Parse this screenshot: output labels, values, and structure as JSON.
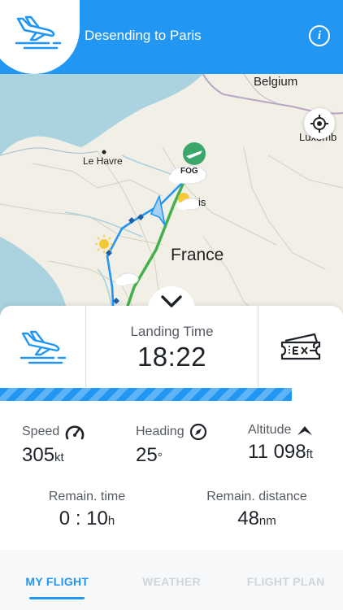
{
  "header": {
    "title": "Desending to Paris",
    "info_icon": "info-icon",
    "logo_icon": "plane-landing-icon",
    "background": "#2196f3"
  },
  "map": {
    "labels": {
      "belgium": "Belgium",
      "luxembourg": "Luxemb",
      "le_havre": "Le Havre",
      "france": "France",
      "paris_fragment": "is",
      "fog": "FOG"
    },
    "locate_icon": "crosshair-icon"
  },
  "summary": {
    "landing_label": "Landing Time",
    "landing_time": "18:22",
    "left_icon": "plane-landing-icon",
    "right_icon": "ticket-icon"
  },
  "progress": {
    "fraction": 0.85,
    "color": "#2196f3"
  },
  "stats": {
    "speed": {
      "label": "Speed",
      "value": "305",
      "unit": "kt",
      "icon": "speedometer-icon"
    },
    "heading": {
      "label": "Heading",
      "value": "25",
      "unit": "°",
      "icon": "compass-icon"
    },
    "altitude": {
      "label": "Altitude",
      "value": "11 098",
      "unit": "ft",
      "icon": "altitude-arrow-icon"
    },
    "remain_time": {
      "label": "Remain. time",
      "value": "0 : 10",
      "unit": "h"
    },
    "remain_distance": {
      "label": "Remain. distance",
      "value": "48",
      "unit": "nm"
    }
  },
  "tabs": [
    {
      "label": "MY FLIGHT",
      "active": true
    },
    {
      "label": "WEATHER",
      "active": false
    },
    {
      "label": "FLIGHT PLAN",
      "active": false
    }
  ]
}
